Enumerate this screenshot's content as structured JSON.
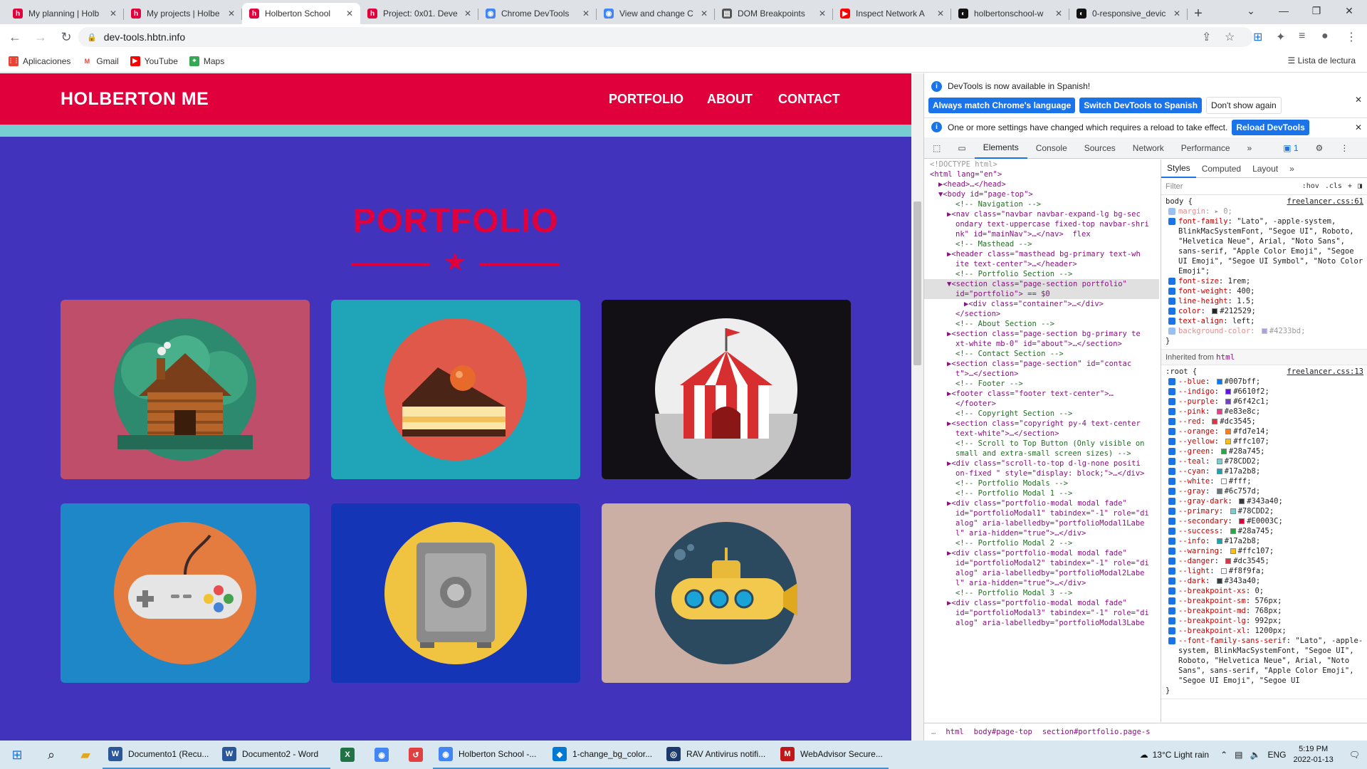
{
  "browser": {
    "tabs": [
      {
        "title": "My planning | Holb",
        "icon": "holberton-favicon-icon",
        "active": false
      },
      {
        "title": "My projects | Holbe",
        "icon": "holberton-favicon-icon",
        "active": false
      },
      {
        "title": "Holberton School",
        "icon": "holberton-favicon-icon",
        "active": true
      },
      {
        "title": "Project: 0x01. Deve",
        "icon": "holberton-favicon-icon",
        "active": false
      },
      {
        "title": "Chrome DevTools",
        "icon": "chrome-favicon-icon",
        "active": false
      },
      {
        "title": "View and change C",
        "icon": "chrome-favicon-icon",
        "active": false
      },
      {
        "title": "DOM Breakpoints",
        "icon": "docs-favicon-icon",
        "active": false
      },
      {
        "title": "Inspect Network A",
        "icon": "youtube-favicon-icon",
        "active": false
      },
      {
        "title": "holbertonschool-w",
        "icon": "github-favicon-icon",
        "active": false
      },
      {
        "title": "0-responsive_devic",
        "icon": "github-favicon-icon",
        "active": false
      }
    ],
    "url": "dev-tools.hbtn.info",
    "bookmarks": [
      {
        "label": "Aplicaciones",
        "icon": "apps-grid-icon"
      },
      {
        "label": "Gmail",
        "icon": "gmail-icon"
      },
      {
        "label": "YouTube",
        "icon": "youtube-icon"
      },
      {
        "label": "Maps",
        "icon": "maps-icon"
      }
    ],
    "reading_list": "Lista de lectura"
  },
  "site": {
    "brand": "HOLBERTON ME",
    "nav": [
      "PORTFOLIO",
      "ABOUT",
      "CONTACT"
    ],
    "section_title": "PORTFOLIO",
    "items": [
      {
        "name": "cabin",
        "bg": "#be4e6a",
        "icon": "cabin-icon"
      },
      {
        "name": "cake",
        "bg": "#1fa5b7",
        "icon": "cake-icon"
      },
      {
        "name": "circus",
        "bg": "#121015",
        "icon": "circus-tent-icon"
      },
      {
        "name": "game",
        "bg": "#1e87c8",
        "icon": "game-controller-icon"
      },
      {
        "name": "safe",
        "bg": "#1535b7",
        "icon": "safe-icon"
      },
      {
        "name": "submarine",
        "bg": "#cbaea4",
        "icon": "submarine-icon"
      }
    ],
    "colors": {
      "primary": "#e0003c",
      "background": "#4233bd",
      "accent": "#78cdd2"
    }
  },
  "devtools": {
    "notice1": "DevTools is now available in Spanish!",
    "notice1_btn1": "Always match Chrome's language",
    "notice1_btn2": "Switch DevTools to Spanish",
    "notice1_btn3": "Don't show again",
    "notice2": "One or more settings have changed which requires a reload to take effect.",
    "notice2_btn": "Reload DevTools",
    "tabs": [
      "Elements",
      "Console",
      "Sources",
      "Network",
      "Performance"
    ],
    "issues_count": "1",
    "side_tabs": [
      "Styles",
      "Computed",
      "Layout"
    ],
    "filter_placeholder": "Filter",
    "filter_hov": ":hov",
    "filter_cls": ".cls",
    "inherited_from_label": "Inherited from",
    "inherited_tag": "html",
    "breadcrumbs": [
      "html",
      "body#page-top",
      "section#portfolio.page-s"
    ]
  },
  "dom_lines": [
    {
      "t": "<!DOCTYPE html>",
      "k": "dots",
      "i": 0
    },
    {
      "t": "<html lang=\"en\">",
      "k": "tag",
      "i": 0
    },
    {
      "t": "▶<head>…</head>",
      "k": "tag",
      "i": 1
    },
    {
      "t": "▼<body id=\"page-top\">",
      "k": "tag",
      "i": 1
    },
    {
      "t": "<!-- Navigation -->",
      "k": "cm",
      "i": 3
    },
    {
      "t": "▶<nav class=\"navbar navbar-expand-lg bg-sec",
      "k": "tag",
      "i": 2
    },
    {
      "t": "ondary text-uppercase fixed-top navbar-shri",
      "k": "tag",
      "i": 3
    },
    {
      "t": "nk\" id=\"mainNav\">…</nav>  flex",
      "k": "tag",
      "i": 3
    },
    {
      "t": "<!-- Masthead -->",
      "k": "cm",
      "i": 3
    },
    {
      "t": "▶<header class=\"masthead bg-primary text-wh",
      "k": "tag",
      "i": 2
    },
    {
      "t": "ite text-center\">…</header>",
      "k": "tag",
      "i": 3
    },
    {
      "t": "<!-- Portfolio Section -->",
      "k": "cm",
      "i": 3
    },
    {
      "t": "▼<section class=\"page-section portfolio\"",
      "k": "tag",
      "i": 2,
      "sel": true
    },
    {
      "t": "id=\"portfolio\"> == $0",
      "k": "tag",
      "i": 3,
      "sel": true
    },
    {
      "t": "▶<div class=\"container\">…</div>",
      "k": "tag",
      "i": 4
    },
    {
      "t": "</section>",
      "k": "tag",
      "i": 3
    },
    {
      "t": "<!-- About Section -->",
      "k": "cm",
      "i": 3
    },
    {
      "t": "▶<section class=\"page-section bg-primary te",
      "k": "tag",
      "i": 2
    },
    {
      "t": "xt-white mb-0\" id=\"about\">…</section>",
      "k": "tag",
      "i": 3
    },
    {
      "t": "<!-- Contact Section -->",
      "k": "cm",
      "i": 3
    },
    {
      "t": "▶<section class=\"page-section\" id=\"contac",
      "k": "tag",
      "i": 2
    },
    {
      "t": "t\">…</section>",
      "k": "tag",
      "i": 3
    },
    {
      "t": "<!-- Footer -->",
      "k": "cm",
      "i": 3
    },
    {
      "t": "▶<footer class=\"footer text-center\">…",
      "k": "tag",
      "i": 2
    },
    {
      "t": "</footer>",
      "k": "tag",
      "i": 3
    },
    {
      "t": "<!-- Copyright Section -->",
      "k": "cm",
      "i": 3
    },
    {
      "t": "▶<section class=\"copyright py-4 text-center",
      "k": "tag",
      "i": 2
    },
    {
      "t": "text-white\">…</section>",
      "k": "tag",
      "i": 3
    },
    {
      "t": "<!-- Scroll to Top Button (Only visible on",
      "k": "cm",
      "i": 3
    },
    {
      "t": "small and extra-small screen sizes) -->",
      "k": "cm",
      "i": 3
    },
    {
      "t": "▶<div class=\"scroll-to-top d-lg-none positi",
      "k": "tag",
      "i": 2
    },
    {
      "t": "on-fixed \" style=\"display: block;\">…</div>",
      "k": "tag",
      "i": 3
    },
    {
      "t": "<!-- Portfolio Modals -->",
      "k": "cm",
      "i": 3
    },
    {
      "t": "<!-- Portfolio Modal 1 -->",
      "k": "cm",
      "i": 3
    },
    {
      "t": "▶<div class=\"portfolio-modal modal fade\"",
      "k": "tag",
      "i": 2
    },
    {
      "t": "id=\"portfolioModal1\" tabindex=\"-1\" role=\"di",
      "k": "tag",
      "i": 3
    },
    {
      "t": "alog\" aria-labelledby=\"portfolioModal1Labe",
      "k": "tag",
      "i": 3
    },
    {
      "t": "l\" aria-hidden=\"true\">…</div>",
      "k": "tag",
      "i": 3
    },
    {
      "t": "<!-- Portfolio Modal 2 -->",
      "k": "cm",
      "i": 3
    },
    {
      "t": "▶<div class=\"portfolio-modal modal fade\"",
      "k": "tag",
      "i": 2
    },
    {
      "t": "id=\"portfolioModal2\" tabindex=\"-1\" role=\"di",
      "k": "tag",
      "i": 3
    },
    {
      "t": "alog\" aria-labelledby=\"portfolioModal2Labe",
      "k": "tag",
      "i": 3
    },
    {
      "t": "l\" aria-hidden=\"true\">…</div>",
      "k": "tag",
      "i": 3
    },
    {
      "t": "<!-- Portfolio Modal 3 -->",
      "k": "cm",
      "i": 3
    },
    {
      "t": "▶<div class=\"portfolio-modal modal fade\"",
      "k": "tag",
      "i": 2
    },
    {
      "t": "id=\"portfolioModal3\" tabindex=\"-1\" role=\"di",
      "k": "tag",
      "i": 3
    },
    {
      "t": "alog\" aria-labelledby=\"portfolioModal3Labe",
      "k": "tag",
      "i": 3
    }
  ],
  "styles": {
    "body_rule": {
      "selector": "body {",
      "source": "freelancer.css:61",
      "props": [
        {
          "n": "margin",
          "v": "▸ 0;",
          "off": true
        },
        {
          "n": "font-family",
          "v": "\"Lato\", -apple-system, BlinkMacSystemFont, \"Segoe UI\", Roboto, \"Helvetica Neue\", Arial, \"Noto Sans\", sans-serif, \"Apple Color Emoji\", \"Segoe UI Emoji\", \"Segoe UI Symbol\", \"Noto Color Emoji\";"
        },
        {
          "n": "font-size",
          "v": "1rem;"
        },
        {
          "n": "font-weight",
          "v": "400;"
        },
        {
          "n": "line-height",
          "v": "1.5;"
        },
        {
          "n": "color",
          "v": "#212529;",
          "sw": "#212529"
        },
        {
          "n": "text-align",
          "v": "left;"
        },
        {
          "n": "background-color",
          "v": "#4233bd;",
          "sw": "#4233bd",
          "off": true
        }
      ]
    },
    "root_rule": {
      "selector": ":root {",
      "source": "freelancer.css:13",
      "props": [
        {
          "n": "--blue",
          "v": "#007bff;",
          "sw": "#007bff"
        },
        {
          "n": "--indigo",
          "v": "#6610f2;",
          "sw": "#6610f2"
        },
        {
          "n": "--purple",
          "v": "#6f42c1;",
          "sw": "#6f42c1"
        },
        {
          "n": "--pink",
          "v": "#e83e8c;",
          "sw": "#e83e8c"
        },
        {
          "n": "--red",
          "v": "#dc3545;",
          "sw": "#dc3545"
        },
        {
          "n": "--orange",
          "v": "#fd7e14;",
          "sw": "#fd7e14"
        },
        {
          "n": "--yellow",
          "v": "#ffc107;",
          "sw": "#ffc107"
        },
        {
          "n": "--green",
          "v": "#28a745;",
          "sw": "#28a745"
        },
        {
          "n": "--teal",
          "v": "#78CDD2;",
          "sw": "#78CDD2"
        },
        {
          "n": "--cyan",
          "v": "#17a2b8;",
          "sw": "#17a2b8"
        },
        {
          "n": "--white",
          "v": "#fff;",
          "sw": "#ffffff"
        },
        {
          "n": "--gray",
          "v": "#6c757d;",
          "sw": "#6c757d"
        },
        {
          "n": "--gray-dark",
          "v": "#343a40;",
          "sw": "#343a40"
        },
        {
          "n": "--primary",
          "v": "#78CDD2;",
          "sw": "#78CDD2"
        },
        {
          "n": "--secondary",
          "v": "#E0003C;",
          "sw": "#E0003C"
        },
        {
          "n": "--success",
          "v": "#28a745;",
          "sw": "#28a745"
        },
        {
          "n": "--info",
          "v": "#17a2b8;",
          "sw": "#17a2b8"
        },
        {
          "n": "--warning",
          "v": "#ffc107;",
          "sw": "#ffc107"
        },
        {
          "n": "--danger",
          "v": "#dc3545;",
          "sw": "#dc3545"
        },
        {
          "n": "--light",
          "v": "#f8f9fa;",
          "sw": "#f8f9fa"
        },
        {
          "n": "--dark",
          "v": "#343a40;",
          "sw": "#343a40"
        },
        {
          "n": "--breakpoint-xs",
          "v": "0;"
        },
        {
          "n": "--breakpoint-sm",
          "v": "576px;"
        },
        {
          "n": "--breakpoint-md",
          "v": "768px;"
        },
        {
          "n": "--breakpoint-lg",
          "v": "992px;"
        },
        {
          "n": "--breakpoint-xl",
          "v": "1200px;"
        },
        {
          "n": "--font-family-sans-serif",
          "v": "\"Lato\", -apple-system, BlinkMacSystemFont, \"Segoe UI\", Roboto, \"Helvetica Neue\", Arial, \"Noto Sans\", sans-serif, \"Apple Color Emoji\", \"Segoe UI Emoji\", \"Segoe UI"
        }
      ]
    }
  },
  "taskbar": {
    "apps": [
      {
        "label": "Documento1 (Recu...",
        "icon": "word-icon"
      },
      {
        "label": "Documento2 - Word",
        "icon": "word-icon"
      },
      {
        "label": "Holberton School -...",
        "icon": "chrome-icon"
      },
      {
        "label": "1-change_bg_color...",
        "icon": "vscode-icon"
      },
      {
        "label": "RAV Antivirus notifi...",
        "icon": "antivirus-icon"
      },
      {
        "label": "WebAdvisor Secure...",
        "icon": "mcafee-icon"
      }
    ],
    "weather": "13°C  Light rain",
    "lang": "ENG",
    "time": "5:19 PM",
    "date": "2022-01-13"
  }
}
